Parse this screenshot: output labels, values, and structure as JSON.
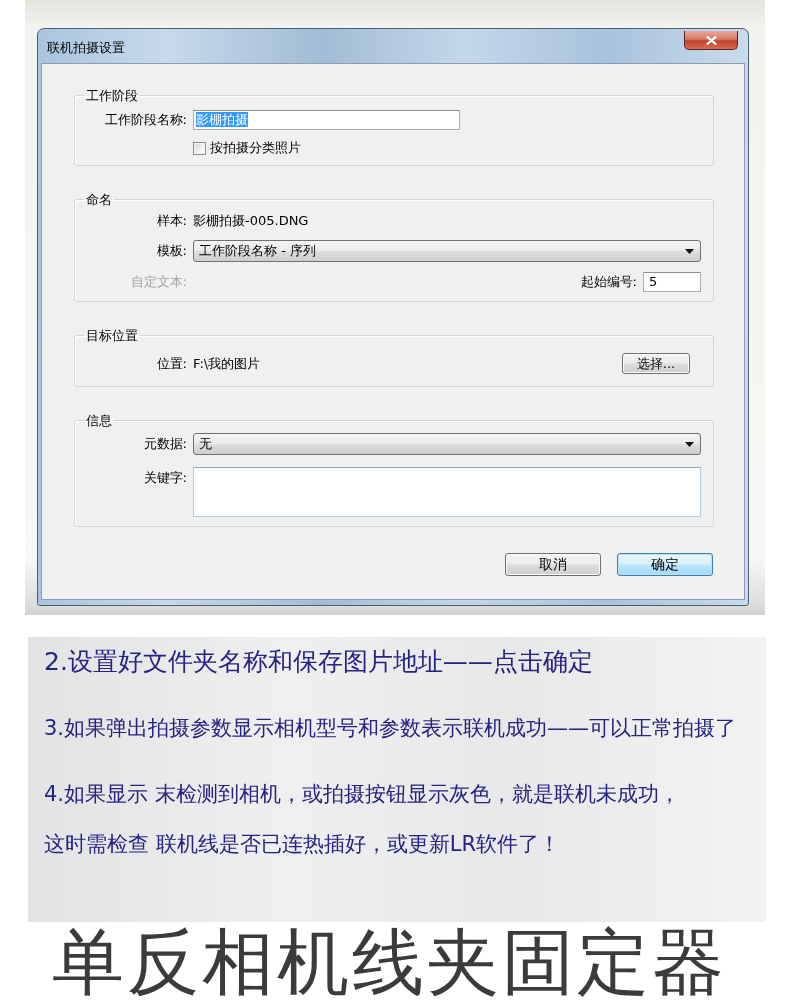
{
  "window": {
    "title": "联机拍摄设置"
  },
  "session": {
    "legend": "工作阶段",
    "name_label": "工作阶段名称:",
    "name_value": "影棚拍摄",
    "name_value_selected": true,
    "sort_checkbox": {
      "label": "按拍摄分类照片",
      "checked": false
    }
  },
  "naming": {
    "legend": "命名",
    "sample_label": "样本:",
    "sample_value": "影棚拍摄-005.DNG",
    "template_label": "模板:",
    "template_value": "工作阶段名称 - 序列",
    "custom_text": {
      "label": "自定文本:",
      "disabled": true
    },
    "start_number_label": "起始编号:",
    "start_number_value": "5"
  },
  "destination": {
    "legend": "目标位置",
    "location_label": "位置:",
    "location_value": "F:\\我的图片",
    "choose_button": "选择..."
  },
  "info": {
    "legend": "信息",
    "metadata_label": "元数据:",
    "metadata_value": "无",
    "keywords_label": "关键字:"
  },
  "buttons": [
    {
      "label": "取消",
      "default": false
    },
    {
      "label": "确定",
      "default": true
    }
  ],
  "instructions": [
    {
      "lines": [
        "2.设置好文件夹名称和保存图片地址——点击确定"
      ]
    },
    {
      "lines": [
        "3.如果弹出拍摄参数显示相机型号和参数表示联机成功——可以正常拍摄了"
      ]
    },
    {
      "lines": [
        "4.如果显示 末检测到相机，或拍摄按钮显示灰色，就是联机未成功，",
        "这时需检查 联机线是否已连热插好，或更新LR软件了！"
      ]
    }
  ],
  "product_title": "单反相机线夹固定器"
}
